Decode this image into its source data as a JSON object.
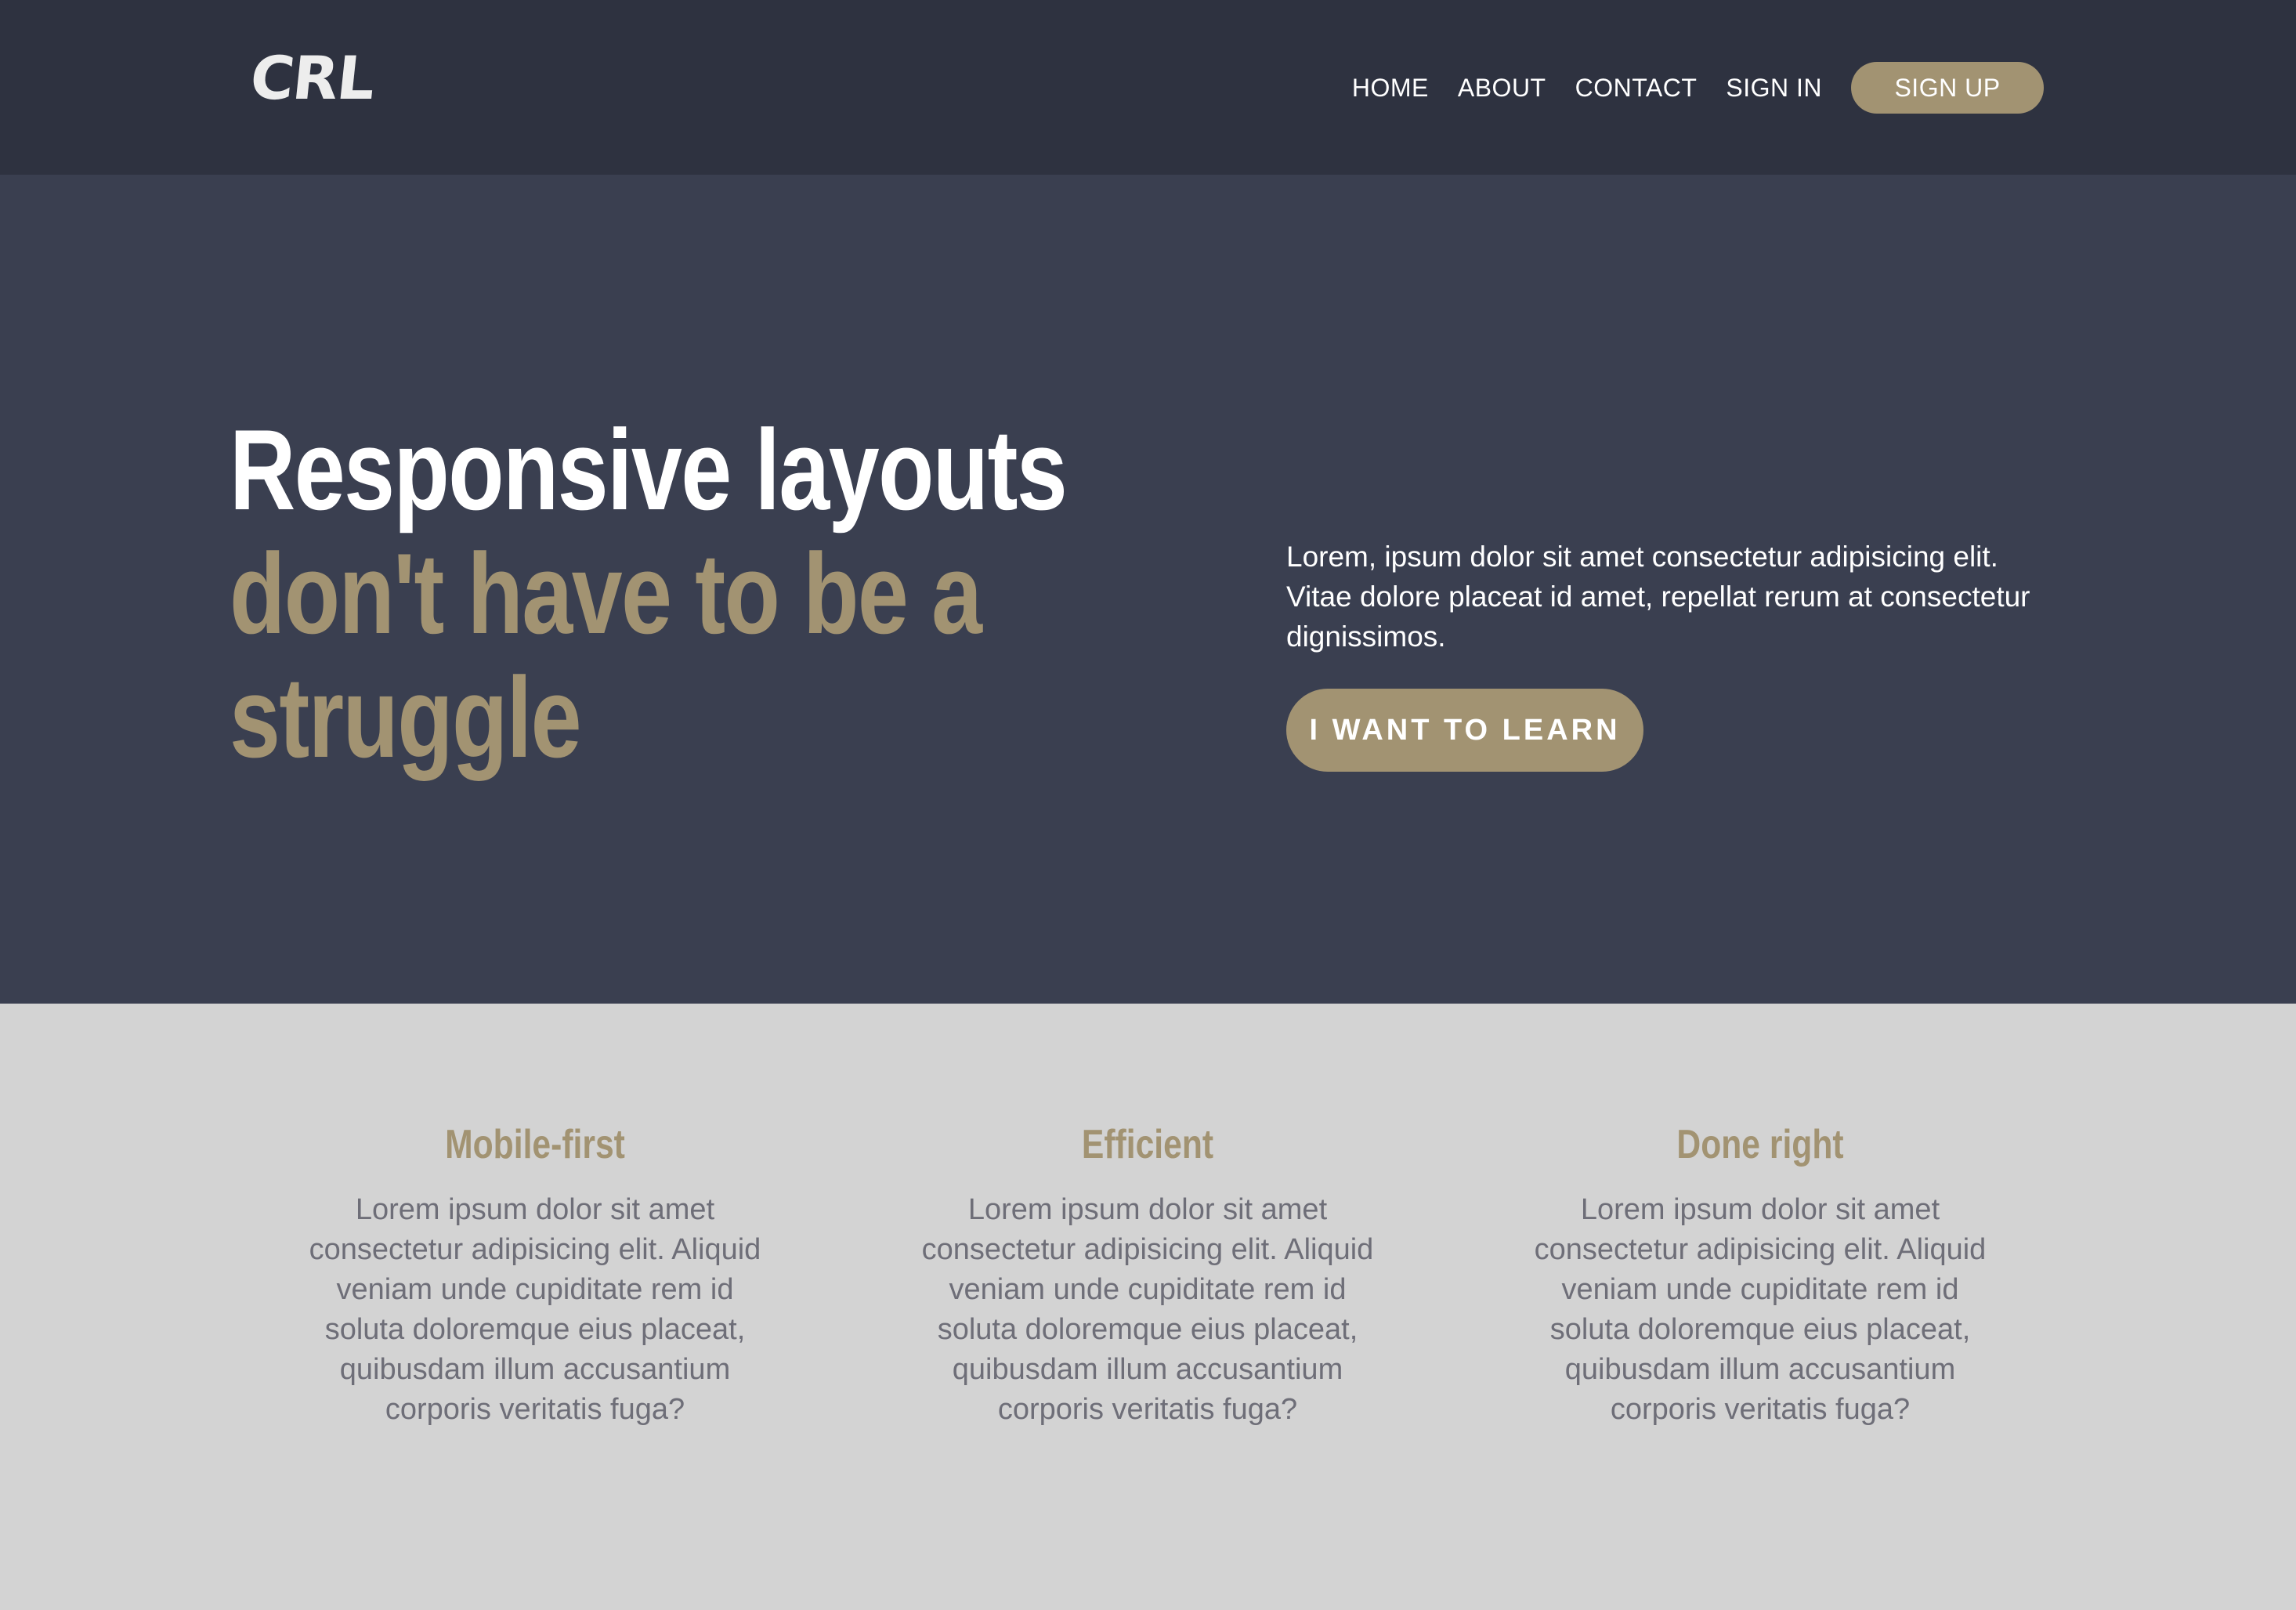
{
  "header": {
    "logo": "CRL",
    "nav": [
      "HOME",
      "ABOUT",
      "CONTACT",
      "SIGN IN"
    ],
    "signup_label": "SIGN UP"
  },
  "hero": {
    "title_line1": "Responsive layouts",
    "title_line2": "don't have to be a struggle",
    "text": "Lorem, ipsum dolor sit amet consectetur adipisicing elit. Vitae dolore placeat id amet, repellat rerum at consectetur dignissimos.",
    "cta_label": "I WANT TO LEARN"
  },
  "features": [
    {
      "title": "Mobile-first",
      "text": "Lorem ipsum dolor sit amet consectetur adipisicing elit. Aliquid veniam unde cupiditate rem id soluta doloremque eius placeat, quibusdam illum accusantium corporis veritatis fuga?"
    },
    {
      "title": "Efficient",
      "text": "Lorem ipsum dolor sit amet consectetur adipisicing elit. Aliquid veniam unde cupiditate rem id soluta doloremque eius placeat, quibusdam illum accusantium corporis veritatis fuga?"
    },
    {
      "title": "Done right",
      "text": "Lorem ipsum dolor sit amet consectetur adipisicing elit. Aliquid veniam unde cupiditate rem id soluta doloremque eius placeat, quibusdam illum accusantium corporis veritatis fuga?"
    }
  ],
  "colors": {
    "header_bg": "#2e3240",
    "hero_bg": "#3a3f50",
    "accent": "#a29372",
    "features_bg": "#d3d3d3"
  }
}
